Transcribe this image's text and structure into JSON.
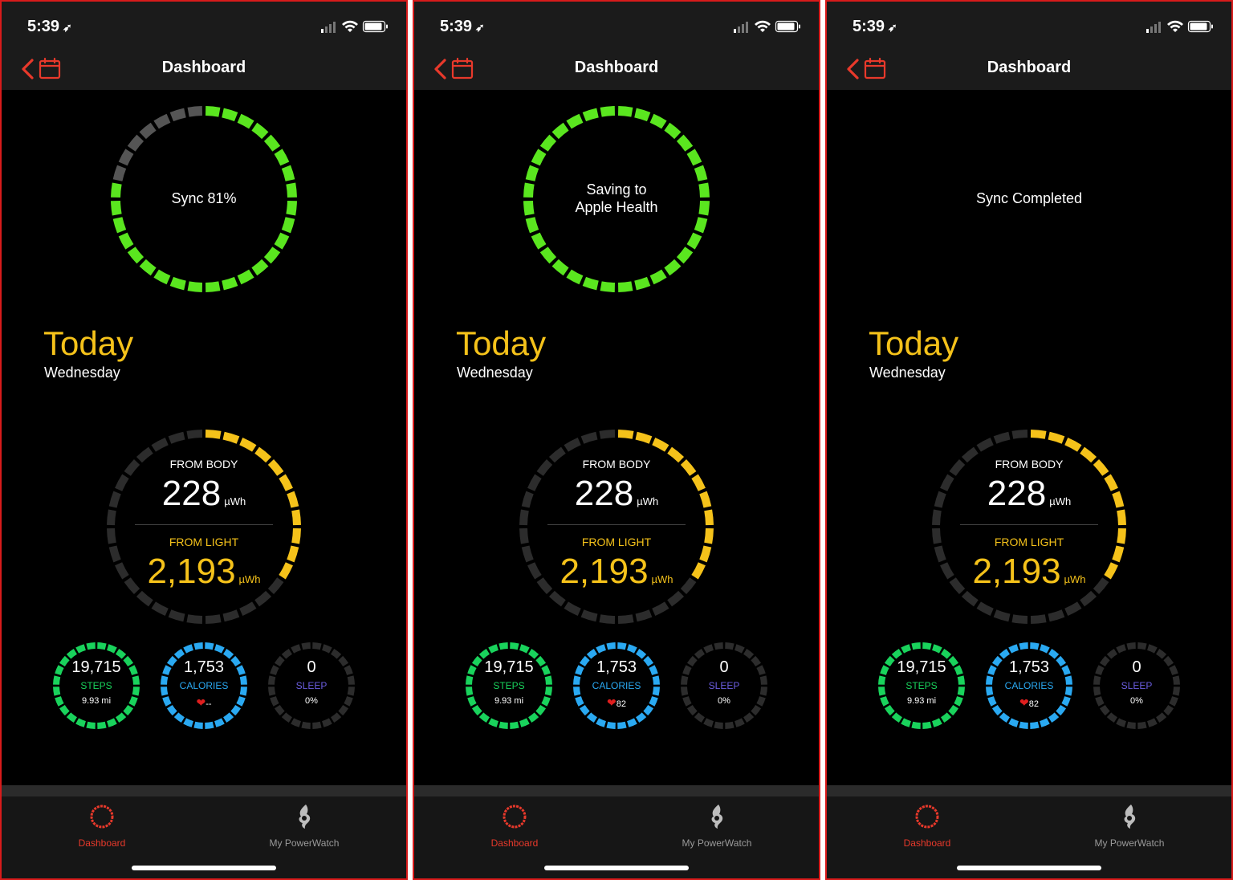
{
  "colors": {
    "frame": "#d81b1b",
    "sync_green": "#5ae61f",
    "light_yellow": "#f5c21a",
    "steps_green": "#19d35c",
    "calories_blue": "#2aa9f2",
    "sleep_purple": "#6b5de0",
    "tab_active": "#e8392b",
    "tab_inactive": "#9a9a9a",
    "track_gray": "#2c2c2c"
  },
  "screens": [
    {
      "status": {
        "time": "5:39",
        "location_icon": "location-arrow-icon"
      },
      "nav": {
        "title": "Dashboard",
        "back_icon": "chevron-left-icon",
        "calendar_icon": "calendar-icon"
      },
      "sync": {
        "text": "Sync 81%",
        "progress": 0.81,
        "ring_visible": true
      },
      "day": {
        "title": "Today",
        "weekday": "Wednesday"
      },
      "energy": {
        "body_label": "FROM BODY",
        "body_value": "228",
        "body_unit": "µWh",
        "light_label": "FROM LIGHT",
        "light_value": "2,193",
        "light_unit": "µWh",
        "light_fraction": 0.36
      },
      "steps": {
        "value": "19,715",
        "label": "STEPS",
        "sub": "9.93 mi",
        "fraction": 1.0
      },
      "calories": {
        "value": "1,753",
        "label": "CALORIES",
        "heart": "❤",
        "heart_rate": "--",
        "fraction": 1.0
      },
      "sleep": {
        "value": "0",
        "label": "SLEEP",
        "sub": "0%",
        "fraction": 0
      },
      "tabs": [
        {
          "label": "Dashboard",
          "icon": "dashboard-ring-icon",
          "active": true
        },
        {
          "label": "My PowerWatch",
          "icon": "powerwatch-flame-icon",
          "active": false
        }
      ]
    },
    {
      "status": {
        "time": "5:39",
        "location_icon": "location-arrow-icon"
      },
      "nav": {
        "title": "Dashboard",
        "back_icon": "chevron-left-icon",
        "calendar_icon": "calendar-icon"
      },
      "sync": {
        "text": "Saving to\nApple Health",
        "progress": 1.0,
        "ring_visible": true
      },
      "day": {
        "title": "Today",
        "weekday": "Wednesday"
      },
      "energy": {
        "body_label": "FROM BODY",
        "body_value": "228",
        "body_unit": "µWh",
        "light_label": "FROM LIGHT",
        "light_value": "2,193",
        "light_unit": "µWh",
        "light_fraction": 0.36
      },
      "steps": {
        "value": "19,715",
        "label": "STEPS",
        "sub": "9.93 mi",
        "fraction": 1.0
      },
      "calories": {
        "value": "1,753",
        "label": "CALORIES",
        "heart": "❤",
        "heart_rate": "82",
        "fraction": 1.0
      },
      "sleep": {
        "value": "0",
        "label": "SLEEP",
        "sub": "0%",
        "fraction": 0
      },
      "tabs": [
        {
          "label": "Dashboard",
          "icon": "dashboard-ring-icon",
          "active": true
        },
        {
          "label": "My PowerWatch",
          "icon": "powerwatch-flame-icon",
          "active": false
        }
      ]
    },
    {
      "status": {
        "time": "5:39",
        "location_icon": "location-arrow-icon"
      },
      "nav": {
        "title": "Dashboard",
        "back_icon": "chevron-left-icon",
        "calendar_icon": "calendar-icon"
      },
      "sync": {
        "text": "Sync Completed",
        "progress": 0,
        "ring_visible": false
      },
      "day": {
        "title": "Today",
        "weekday": "Wednesday"
      },
      "energy": {
        "body_label": "FROM BODY",
        "body_value": "228",
        "body_unit": "µWh",
        "light_label": "FROM LIGHT",
        "light_value": "2,193",
        "light_unit": "µWh",
        "light_fraction": 0.36
      },
      "steps": {
        "value": "19,715",
        "label": "STEPS",
        "sub": "9.93 mi",
        "fraction": 1.0
      },
      "calories": {
        "value": "1,753",
        "label": "CALORIES",
        "heart": "❤",
        "heart_rate": "82",
        "fraction": 1.0
      },
      "sleep": {
        "value": "0",
        "label": "SLEEP",
        "sub": "0%",
        "fraction": 0
      },
      "tabs": [
        {
          "label": "Dashboard",
          "icon": "dashboard-ring-icon",
          "active": true
        },
        {
          "label": "My PowerWatch",
          "icon": "powerwatch-flame-icon",
          "active": false
        }
      ]
    }
  ]
}
